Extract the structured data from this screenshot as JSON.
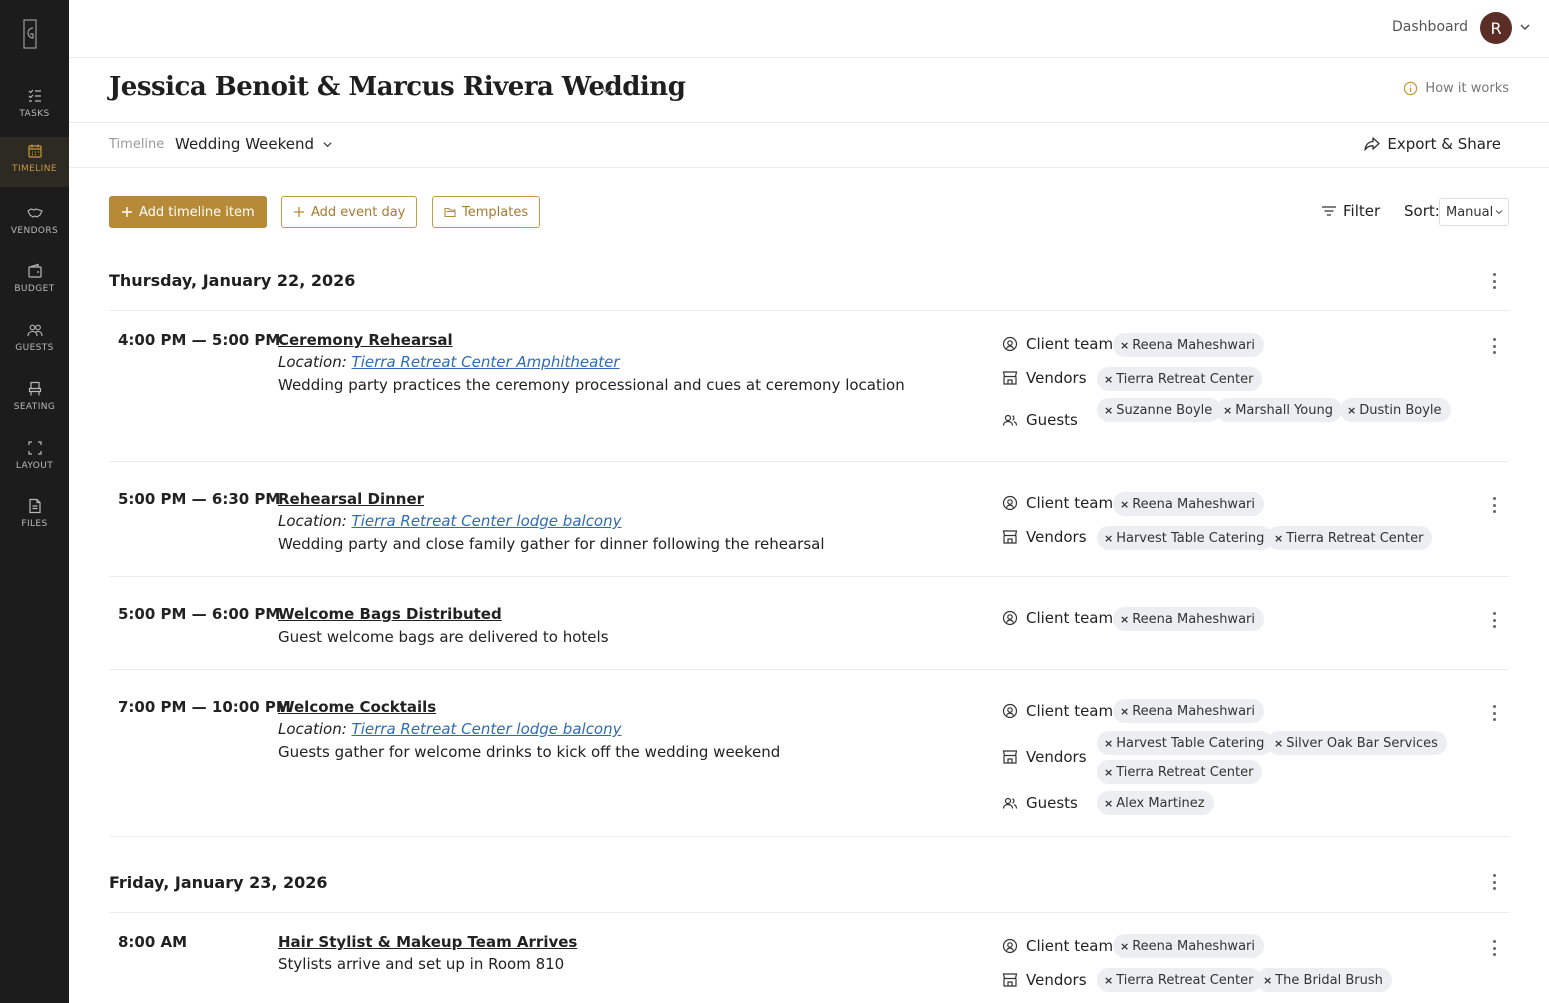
{
  "nav": {
    "logo_letter": "G",
    "items": [
      {
        "label": "TASKS",
        "icon": "tasks-icon"
      },
      {
        "label": "TIMELINE",
        "icon": "calendar-icon",
        "active": true
      },
      {
        "label": "VENDORS",
        "icon": "handshake-icon"
      },
      {
        "label": "BUDGET",
        "icon": "wallet-icon"
      },
      {
        "label": "GUESTS",
        "icon": "users-icon"
      },
      {
        "label": "SEATING",
        "icon": "chair-icon"
      },
      {
        "label": "LAYOUT",
        "icon": "expand-icon"
      },
      {
        "label": "FILES",
        "icon": "file-icon"
      }
    ]
  },
  "topbar": {
    "dashboard": "Dashboard",
    "avatar_initial": "R"
  },
  "header": {
    "title": "Jessica Benoit & Marcus Rivera Wedding",
    "how_it_works": "How it works"
  },
  "subheader": {
    "timeline_label": "Timeline",
    "timeline_select": "Wedding Weekend",
    "export_share": "Export & Share"
  },
  "toolbar": {
    "add_item": "Add timeline item",
    "add_day": "Add event day",
    "templates": "Templates",
    "filter": "Filter",
    "sort_label": "Sort:",
    "sort_value": "Manual"
  },
  "roles": {
    "client_team": "Client team",
    "vendors": "Vendors",
    "guests": "Guests"
  },
  "location_prefix": "Location:",
  "days": [
    {
      "date": "Thursday, January 22, 2026",
      "items": [
        {
          "time": "4:00 PM — 5:00 PM",
          "title": "Ceremony Rehearsal",
          "location": "Tierra Retreat Center Amphitheater",
          "description": "Wedding party practices the ceremony processional and cues at ceremony location",
          "client_team": [
            "Reena Maheshwari"
          ],
          "vendors": [
            "Tierra Retreat Center"
          ],
          "guests": [
            "Suzanne Boyle",
            "Marshall Young",
            "Dustin Boyle"
          ]
        },
        {
          "time": "5:00 PM — 6:30 PM",
          "title": "Rehearsal Dinner",
          "location": "Tierra Retreat Center lodge balcony",
          "description": "Wedding party and close family gather for dinner following the rehearsal",
          "client_team": [
            "Reena Maheshwari"
          ],
          "vendors": [
            "Harvest Table Catering",
            "Tierra Retreat Center"
          ]
        },
        {
          "time": "5:00 PM — 6:00 PM",
          "title": "Welcome Bags Distributed",
          "description": "Guest welcome bags are delivered to hotels",
          "client_team": [
            "Reena Maheshwari"
          ]
        },
        {
          "time": "7:00 PM — 10:00 PM",
          "title": "Welcome Cocktails",
          "location": "Tierra Retreat Center lodge balcony",
          "description": "Guests gather for welcome drinks to kick off the wedding weekend",
          "client_team": [
            "Reena Maheshwari"
          ],
          "vendors": [
            "Harvest Table Catering",
            "Silver Oak Bar Services",
            "Tierra Retreat Center"
          ],
          "guests": [
            "Alex Martinez"
          ]
        }
      ]
    },
    {
      "date": "Friday, January 23, 2026",
      "items": [
        {
          "time": "8:00 AM",
          "title": "Hair Stylist & Makeup Team Arrives",
          "description": "Stylists arrive and set up in Room 810",
          "client_team": [
            "Reena Maheshwari"
          ],
          "vendors": [
            "Tierra Retreat Center",
            "The Bridal Brush"
          ]
        }
      ]
    }
  ]
}
